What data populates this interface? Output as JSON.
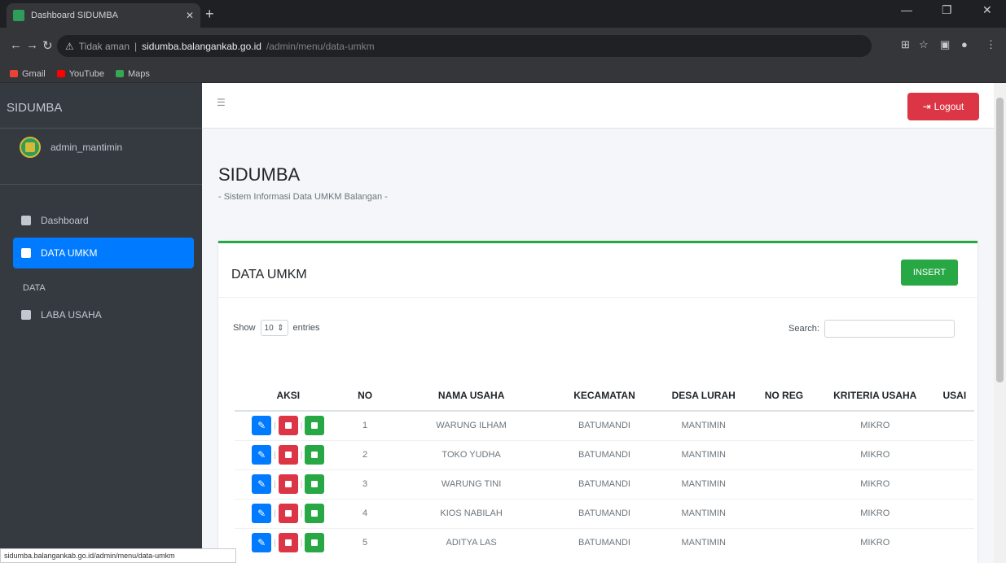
{
  "browser": {
    "tab_title": "Dashboard SIDUMBA",
    "security_label": "Tidak aman",
    "url_host": "sidumba.balangankab.go.id",
    "url_path": "/admin/menu/data-umkm",
    "bookmarks": [
      {
        "label": "Gmail",
        "color": "#ea4335"
      },
      {
        "label": "YouTube",
        "color": "#ff0000"
      },
      {
        "label": "Maps",
        "color": "#34a853"
      }
    ],
    "status_url": "sidumba.balangankab.go.id/admin/menu/data-umkm"
  },
  "sidebar": {
    "brand": "SIDUMBA",
    "user": "admin_mantimin",
    "items": [
      {
        "label": "Dashboard",
        "active": false
      },
      {
        "label": "DATA UMKM",
        "active": true
      }
    ],
    "section_header": "DATA",
    "section_items": [
      {
        "label": "LABA USAHA"
      }
    ]
  },
  "header": {
    "logout_label": "Logout",
    "page_title": "SIDUMBA",
    "page_subtitle": "- Sistem Informasi Data UMKM Balangan -"
  },
  "card": {
    "title": "DATA UMKM",
    "insert_label": "INSERT",
    "show_label": "Show",
    "entries_value": "10",
    "entries_label": "entries",
    "search_label": "Search:"
  },
  "table": {
    "columns": [
      "AKSI",
      "NO",
      "NAMA USAHA",
      "KECAMATAN",
      "DESA LURAH",
      "NO REG",
      "KRITERIA USAHA",
      "USAI"
    ],
    "rows": [
      {
        "no": "1",
        "nama": "WARUNG ILHAM",
        "kecamatan": "BATUMANDI",
        "desa": "MANTIMIN",
        "noreg": "",
        "kriteria": "MIKRO"
      },
      {
        "no": "2",
        "nama": "TOKO YUDHA",
        "kecamatan": "BATUMANDI",
        "desa": "MANTIMIN",
        "noreg": "",
        "kriteria": "MIKRO"
      },
      {
        "no": "3",
        "nama": "WARUNG TINI",
        "kecamatan": "BATUMANDI",
        "desa": "MANTIMIN",
        "noreg": "",
        "kriteria": "MIKRO"
      },
      {
        "no": "4",
        "nama": "KIOS NABILAH",
        "kecamatan": "BATUMANDI",
        "desa": "MANTIMIN",
        "noreg": "",
        "kriteria": "MIKRO"
      },
      {
        "no": "5",
        "nama": "ADITYA LAS",
        "kecamatan": "BATUMANDI",
        "desa": "MANTIMIN",
        "noreg": "",
        "kriteria": "MIKRO"
      }
    ]
  },
  "colors": {
    "primary": "#007bff",
    "danger": "#dc3545",
    "success": "#28a745",
    "sidebar": "#343a40"
  }
}
